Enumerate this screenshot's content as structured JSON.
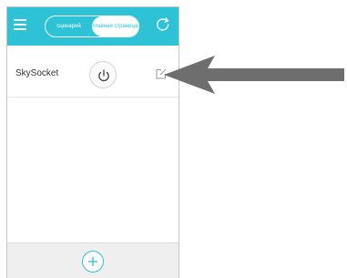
{
  "header": {
    "tab_scenario": "сценарий",
    "tab_home": "главная страница",
    "accent_color": "#2ec2d6"
  },
  "devices": [
    {
      "name": "SkySocket",
      "power_icon": "power-icon",
      "edit_icon": "edit-icon"
    }
  ],
  "footer": {
    "add_icon": "plus-icon"
  },
  "annotation": {
    "arrow_color": "#6e6e6e"
  }
}
